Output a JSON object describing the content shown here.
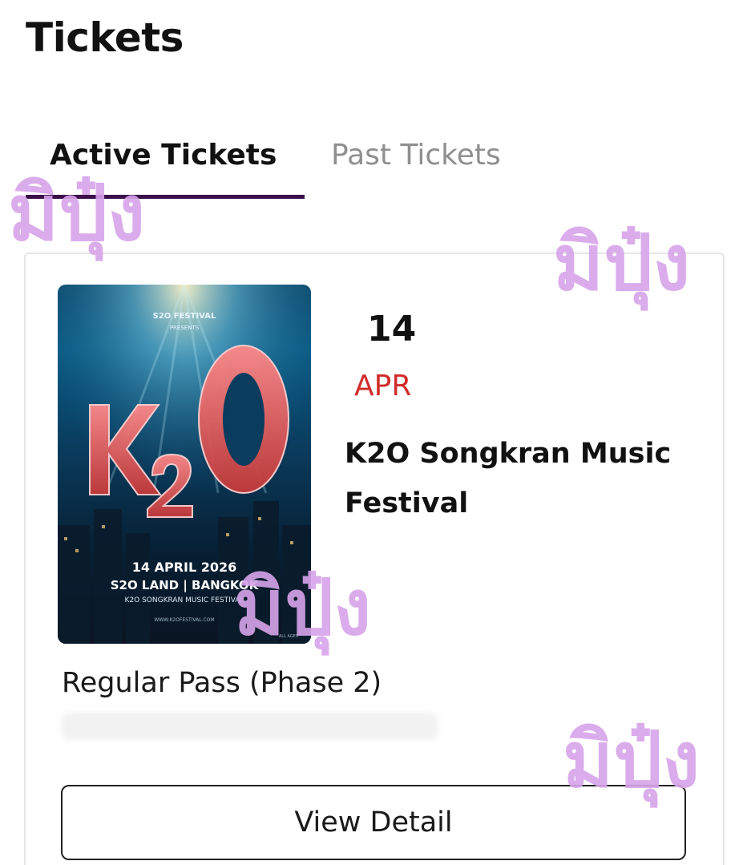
{
  "header": {
    "title": "Tickets"
  },
  "tabs": [
    {
      "label": "Active Tickets",
      "active": true
    },
    {
      "label": "Past Tickets",
      "active": false
    }
  ],
  "ticket": {
    "poster": {
      "line1": "S2O FESTIVAL",
      "line2": "PRESENTS",
      "logo": "K2O",
      "date": "14 APRIL 2026",
      "venue": "S2O LAND | BANGKOK",
      "event": "K2O SONGKRAN MUSIC FESTIVAL",
      "url": "WWW.K2OFESTIVAL.COM",
      "rating": "ALL AGES"
    },
    "day": "14",
    "month": "APR",
    "event_name": "K2O Songkran Music Festival",
    "pass_name": "Regular Pass (Phase 2)",
    "view_detail_label": "View Detail"
  },
  "watermark": {
    "text": "มิปุ๋ง"
  },
  "colors": {
    "tab_underline": "#3a0f4a",
    "month": "#d22b2b",
    "watermark": "#d8a4ea"
  }
}
